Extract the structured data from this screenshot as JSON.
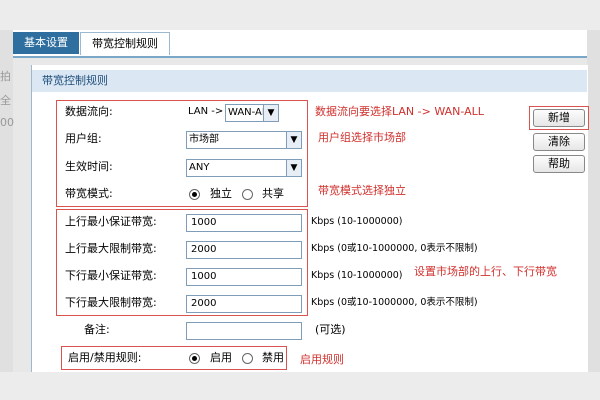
{
  "background": {
    "top_fragment": "",
    "left_fragments": [
      "拍",
      "全",
      "00"
    ]
  },
  "tabs": [
    {
      "label": "基本设置",
      "active": false
    },
    {
      "label": "带宽控制规则",
      "active": true
    }
  ],
  "section_title": "带宽控制规则",
  "form": {
    "direction": {
      "label": "数据流向:",
      "prefix": "LAN ->",
      "value": "WAN-AL"
    },
    "user_group": {
      "label": "用户组:",
      "value": "市场部"
    },
    "effective_time": {
      "label": "生效时间:",
      "value": "ANY"
    },
    "bandwidth_mode": {
      "label": "带宽模式:",
      "options": [
        "独立",
        "共享"
      ],
      "selected": "独立"
    },
    "up_min": {
      "label": "上行最小保证带宽:",
      "value": "1000",
      "hint": "Kbps (10-1000000)"
    },
    "up_max": {
      "label": "上行最大限制带宽:",
      "value": "2000",
      "hint": "Kbps (0或10-1000000, 0表示不限制)"
    },
    "down_min": {
      "label": "下行最小保证带宽:",
      "value": "1000",
      "hint": "Kbps (10-1000000)"
    },
    "down_max": {
      "label": "下行最大限制带宽:",
      "value": "2000",
      "hint": "Kbps (0或10-1000000, 0表示不限制)"
    },
    "remark": {
      "label": "备注:",
      "value": "",
      "hint": "(可选)"
    },
    "rule_status": {
      "label": "启用/禁用规则:",
      "options": [
        "启用",
        "禁用"
      ],
      "selected": "启用"
    }
  },
  "annotations": {
    "direction": "数据流向要选择LAN -> WAN-ALL",
    "user_group": "用户组选择市场部",
    "mode": "带宽模式选择独立",
    "bandwidth": "设置市场部的上行、下行带宽",
    "enable": "启用规则"
  },
  "buttons": {
    "add": "新增",
    "clear": "清除",
    "help": "帮助"
  },
  "colors": {
    "annotation_red": "#d0312d",
    "tab_blue": "#2f6f9f",
    "section_bg": "#dbe8f4"
  }
}
